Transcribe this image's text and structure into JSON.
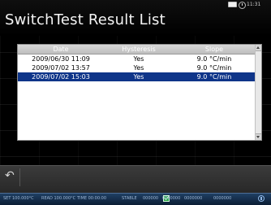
{
  "window": {
    "title": "SwitchTest Result List",
    "time": "11:31"
  },
  "table": {
    "headers": {
      "date": "Date",
      "hysteresis": "Hysteresis",
      "slope": "Slope"
    },
    "rows": [
      {
        "date": "2009/06/30 11:09",
        "hysteresis": "Yes",
        "slope": "9.0 °C/min",
        "selected": false
      },
      {
        "date": "2009/07/02 13:57",
        "hysteresis": "Yes",
        "slope": "9.0 °C/min",
        "selected": false
      },
      {
        "date": "2009/07/02 15:03",
        "hysteresis": "Yes",
        "slope": "9.0 °C/min",
        "selected": true
      }
    ]
  },
  "action_bar": {
    "back_icon": "back-icon"
  },
  "status_bar": {
    "items": [
      "SET 100.000°C",
      "READ 100.000°C",
      "TIME 00:00:00",
      "STABLE",
      "000000",
      "0000000",
      "0000000",
      "0000000"
    ],
    "icons": [
      "check-icon",
      "status-icon"
    ]
  },
  "colors": {
    "selection": "#0f3589",
    "background": "#000000",
    "panel": "#ffffff"
  }
}
